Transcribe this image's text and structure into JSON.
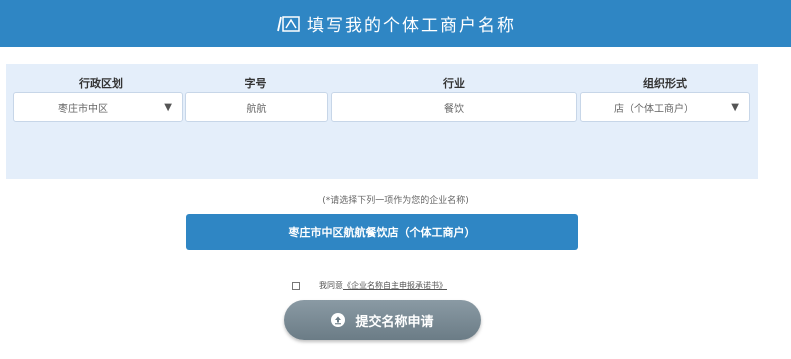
{
  "header": {
    "title": "填写我的个体工商户名称",
    "icon": "document-icon"
  },
  "form": {
    "columns": {
      "district": {
        "label": "行政区划",
        "value": "枣庄市中区",
        "type": "select"
      },
      "trade_name": {
        "label": "字号",
        "value": "航航",
        "type": "input"
      },
      "industry": {
        "label": "行业",
        "value": "餐饮",
        "type": "input"
      },
      "org_form": {
        "label": "组织形式",
        "value": "店（个体工商户）",
        "type": "select"
      }
    },
    "dropdown_caret": "▼"
  },
  "hint": "(*请选择下列一项作为您的企业名称)",
  "name_options": [
    {
      "label": "枣庄市中区航航餐饮店（个体工商户）"
    }
  ],
  "agreement": {
    "prefix": "我同意",
    "link": "《企业名称自主申报承诺书》",
    "checked": false
  },
  "submit": {
    "label": "提交名称申请",
    "icon": "upload-icon"
  },
  "colors": {
    "header_bg": "#2f86c4",
    "panel_bg": "#e4eefa",
    "button_gray": "#7a8b95"
  }
}
